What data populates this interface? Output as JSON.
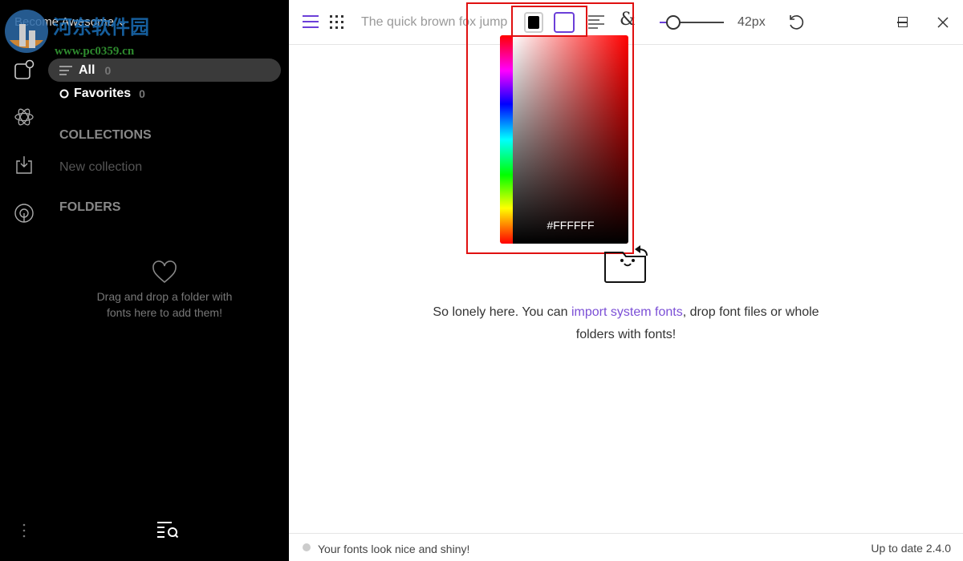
{
  "sidebar": {
    "brand": "Become Awesome",
    "all": {
      "label": "All",
      "count": "0"
    },
    "favorites": {
      "label": "Favorites",
      "count": "0"
    },
    "collections_heading": "COLLECTIONS",
    "new_collection": "New collection",
    "folders_heading": "FOLDERS",
    "drop_line1": "Drag and drop a folder with",
    "drop_line2": "fonts here to add them!"
  },
  "watermark": {
    "line1": "河东软件园",
    "line2": "www.pc0359.cn"
  },
  "toolbar": {
    "sample_text": "The quick brown fox jumps",
    "font_size": "42px",
    "size_value": 42,
    "accent": "#6b3fd8"
  },
  "picker": {
    "hex": "#FFFFFF",
    "foreground": "#000000",
    "background": "#FFFFFF"
  },
  "empty": {
    "pre": "So lonely here. You can ",
    "link": "import system fonts",
    "post": ", drop font files or whole",
    "line2": "folders with fonts!"
  },
  "status": {
    "message": "Your fonts look nice and shiny!",
    "version": "Up to date 2.4.0"
  }
}
